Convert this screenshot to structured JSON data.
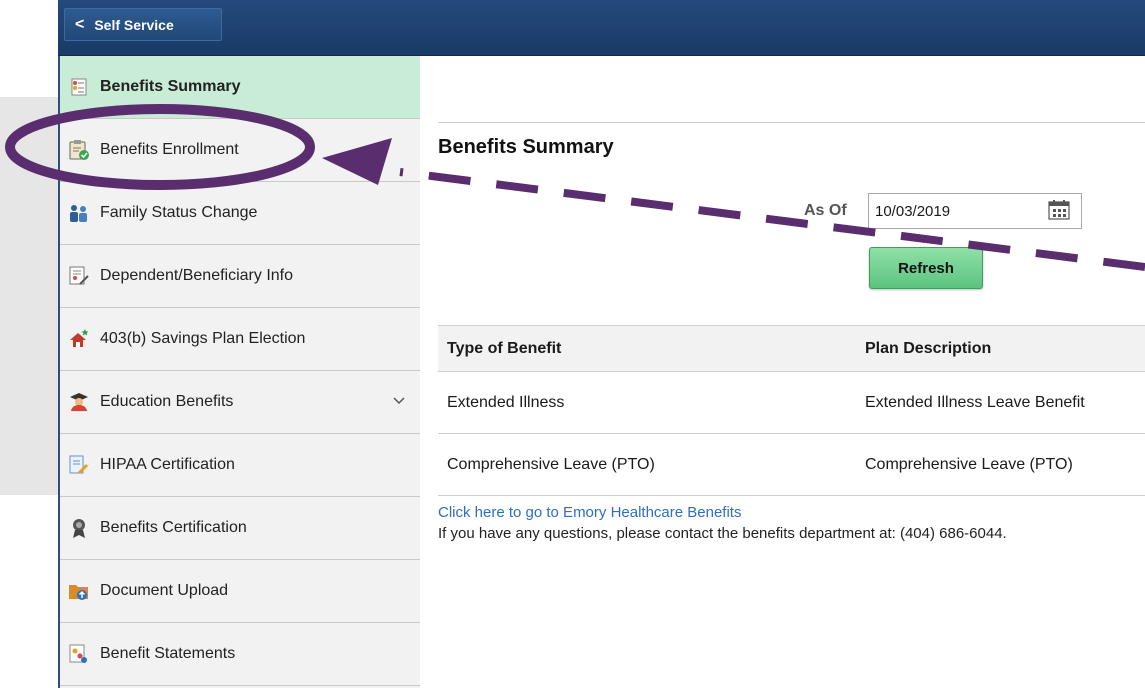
{
  "topbar": {
    "back_label": "Self Service"
  },
  "sidebar": {
    "items": [
      {
        "label": "Benefits Summary",
        "icon": "benefits-summary-icon"
      },
      {
        "label": "Benefits Enrollment",
        "icon": "clipboard-check-icon"
      },
      {
        "label": "Family Status Change",
        "icon": "family-icon"
      },
      {
        "label": "Dependent/Beneficiary Info",
        "icon": "form-edit-icon"
      },
      {
        "label": "403(b) Savings Plan Election",
        "icon": "house-star-icon"
      },
      {
        "label": "Education Benefits",
        "icon": "graduate-icon"
      },
      {
        "label": "HIPAA Certification",
        "icon": "document-pencil-icon"
      },
      {
        "label": "Benefits Certification",
        "icon": "ribbon-award-icon"
      },
      {
        "label": "Document Upload",
        "icon": "folder-upload-icon"
      },
      {
        "label": "Benefit Statements",
        "icon": "statements-icon"
      }
    ],
    "active_index": 0
  },
  "main": {
    "title": "Benefits Summary",
    "as_of_label": "As Of",
    "as_of_value": "10/03/2019",
    "refresh_label": "Refresh",
    "table": {
      "headers": [
        "Type of Benefit",
        "Plan Description"
      ],
      "rows": [
        [
          "Extended Illness",
          "Extended Illness Leave Benefit"
        ],
        [
          "Comprehensive Leave (PTO)",
          "Comprehensive Leave (PTO)"
        ]
      ]
    },
    "link_text": "Click here to go to Emory Healthcare Benefits",
    "contact_text": "If you have any questions, please contact the benefits department at: (404) 686-6044."
  },
  "colors": {
    "topbar": "#1f4271",
    "active_item": "#c9ecd6",
    "refresh_button": "#6fd08f",
    "annotation": "#5a2d6e",
    "link": "#2f6fc0"
  }
}
